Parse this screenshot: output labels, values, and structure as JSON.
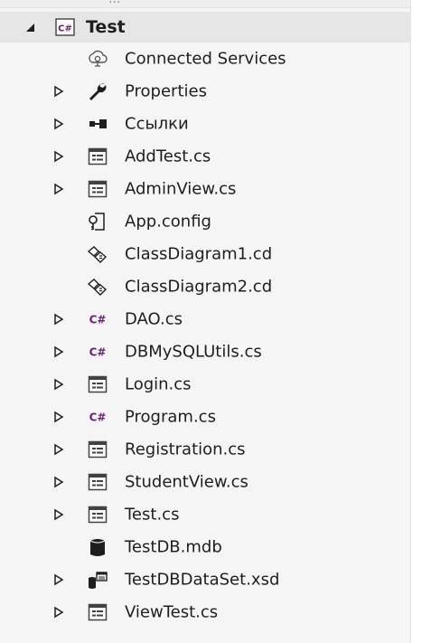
{
  "top_strip_text": "...",
  "tree": {
    "root": {
      "label": "Test",
      "icon": "csharp-project-icon",
      "expanded": true
    },
    "items": [
      {
        "label": "Connected Services",
        "icon": "connected-services-icon",
        "expander": false
      },
      {
        "label": "Properties",
        "icon": "wrench-icon",
        "expander": true
      },
      {
        "label": "Ссылки",
        "icon": "references-icon",
        "expander": true
      },
      {
        "label": "AddTest.cs",
        "icon": "form-icon",
        "expander": true
      },
      {
        "label": "AdminView.cs",
        "icon": "form-icon",
        "expander": true
      },
      {
        "label": "App.config",
        "icon": "config-file-icon",
        "expander": false
      },
      {
        "label": "ClassDiagram1.cd",
        "icon": "class-diagram-icon",
        "expander": false
      },
      {
        "label": "ClassDiagram2.cd",
        "icon": "class-diagram-icon",
        "expander": false
      },
      {
        "label": "DAO.cs",
        "icon": "csharp-file-icon",
        "expander": true
      },
      {
        "label": "DBMySQLUtils.cs",
        "icon": "csharp-file-icon",
        "expander": true
      },
      {
        "label": "Login.cs",
        "icon": "form-icon",
        "expander": true
      },
      {
        "label": "Program.cs",
        "icon": "csharp-file-icon",
        "expander": true
      },
      {
        "label": "Registration.cs",
        "icon": "form-icon",
        "expander": true
      },
      {
        "label": "StudentView.cs",
        "icon": "form-icon",
        "expander": true
      },
      {
        "label": "Test.cs",
        "icon": "form-icon",
        "expander": true
      },
      {
        "label": "TestDB.mdb",
        "icon": "database-icon",
        "expander": false
      },
      {
        "label": "TestDBDataSet.xsd",
        "icon": "dataset-icon",
        "expander": true
      },
      {
        "label": "ViewTest.cs",
        "icon": "form-icon",
        "expander": true
      }
    ]
  },
  "colors": {
    "csharp_purple": "#68217a",
    "text": "#1e1e1e",
    "selected_row": "#e6e6e6"
  }
}
